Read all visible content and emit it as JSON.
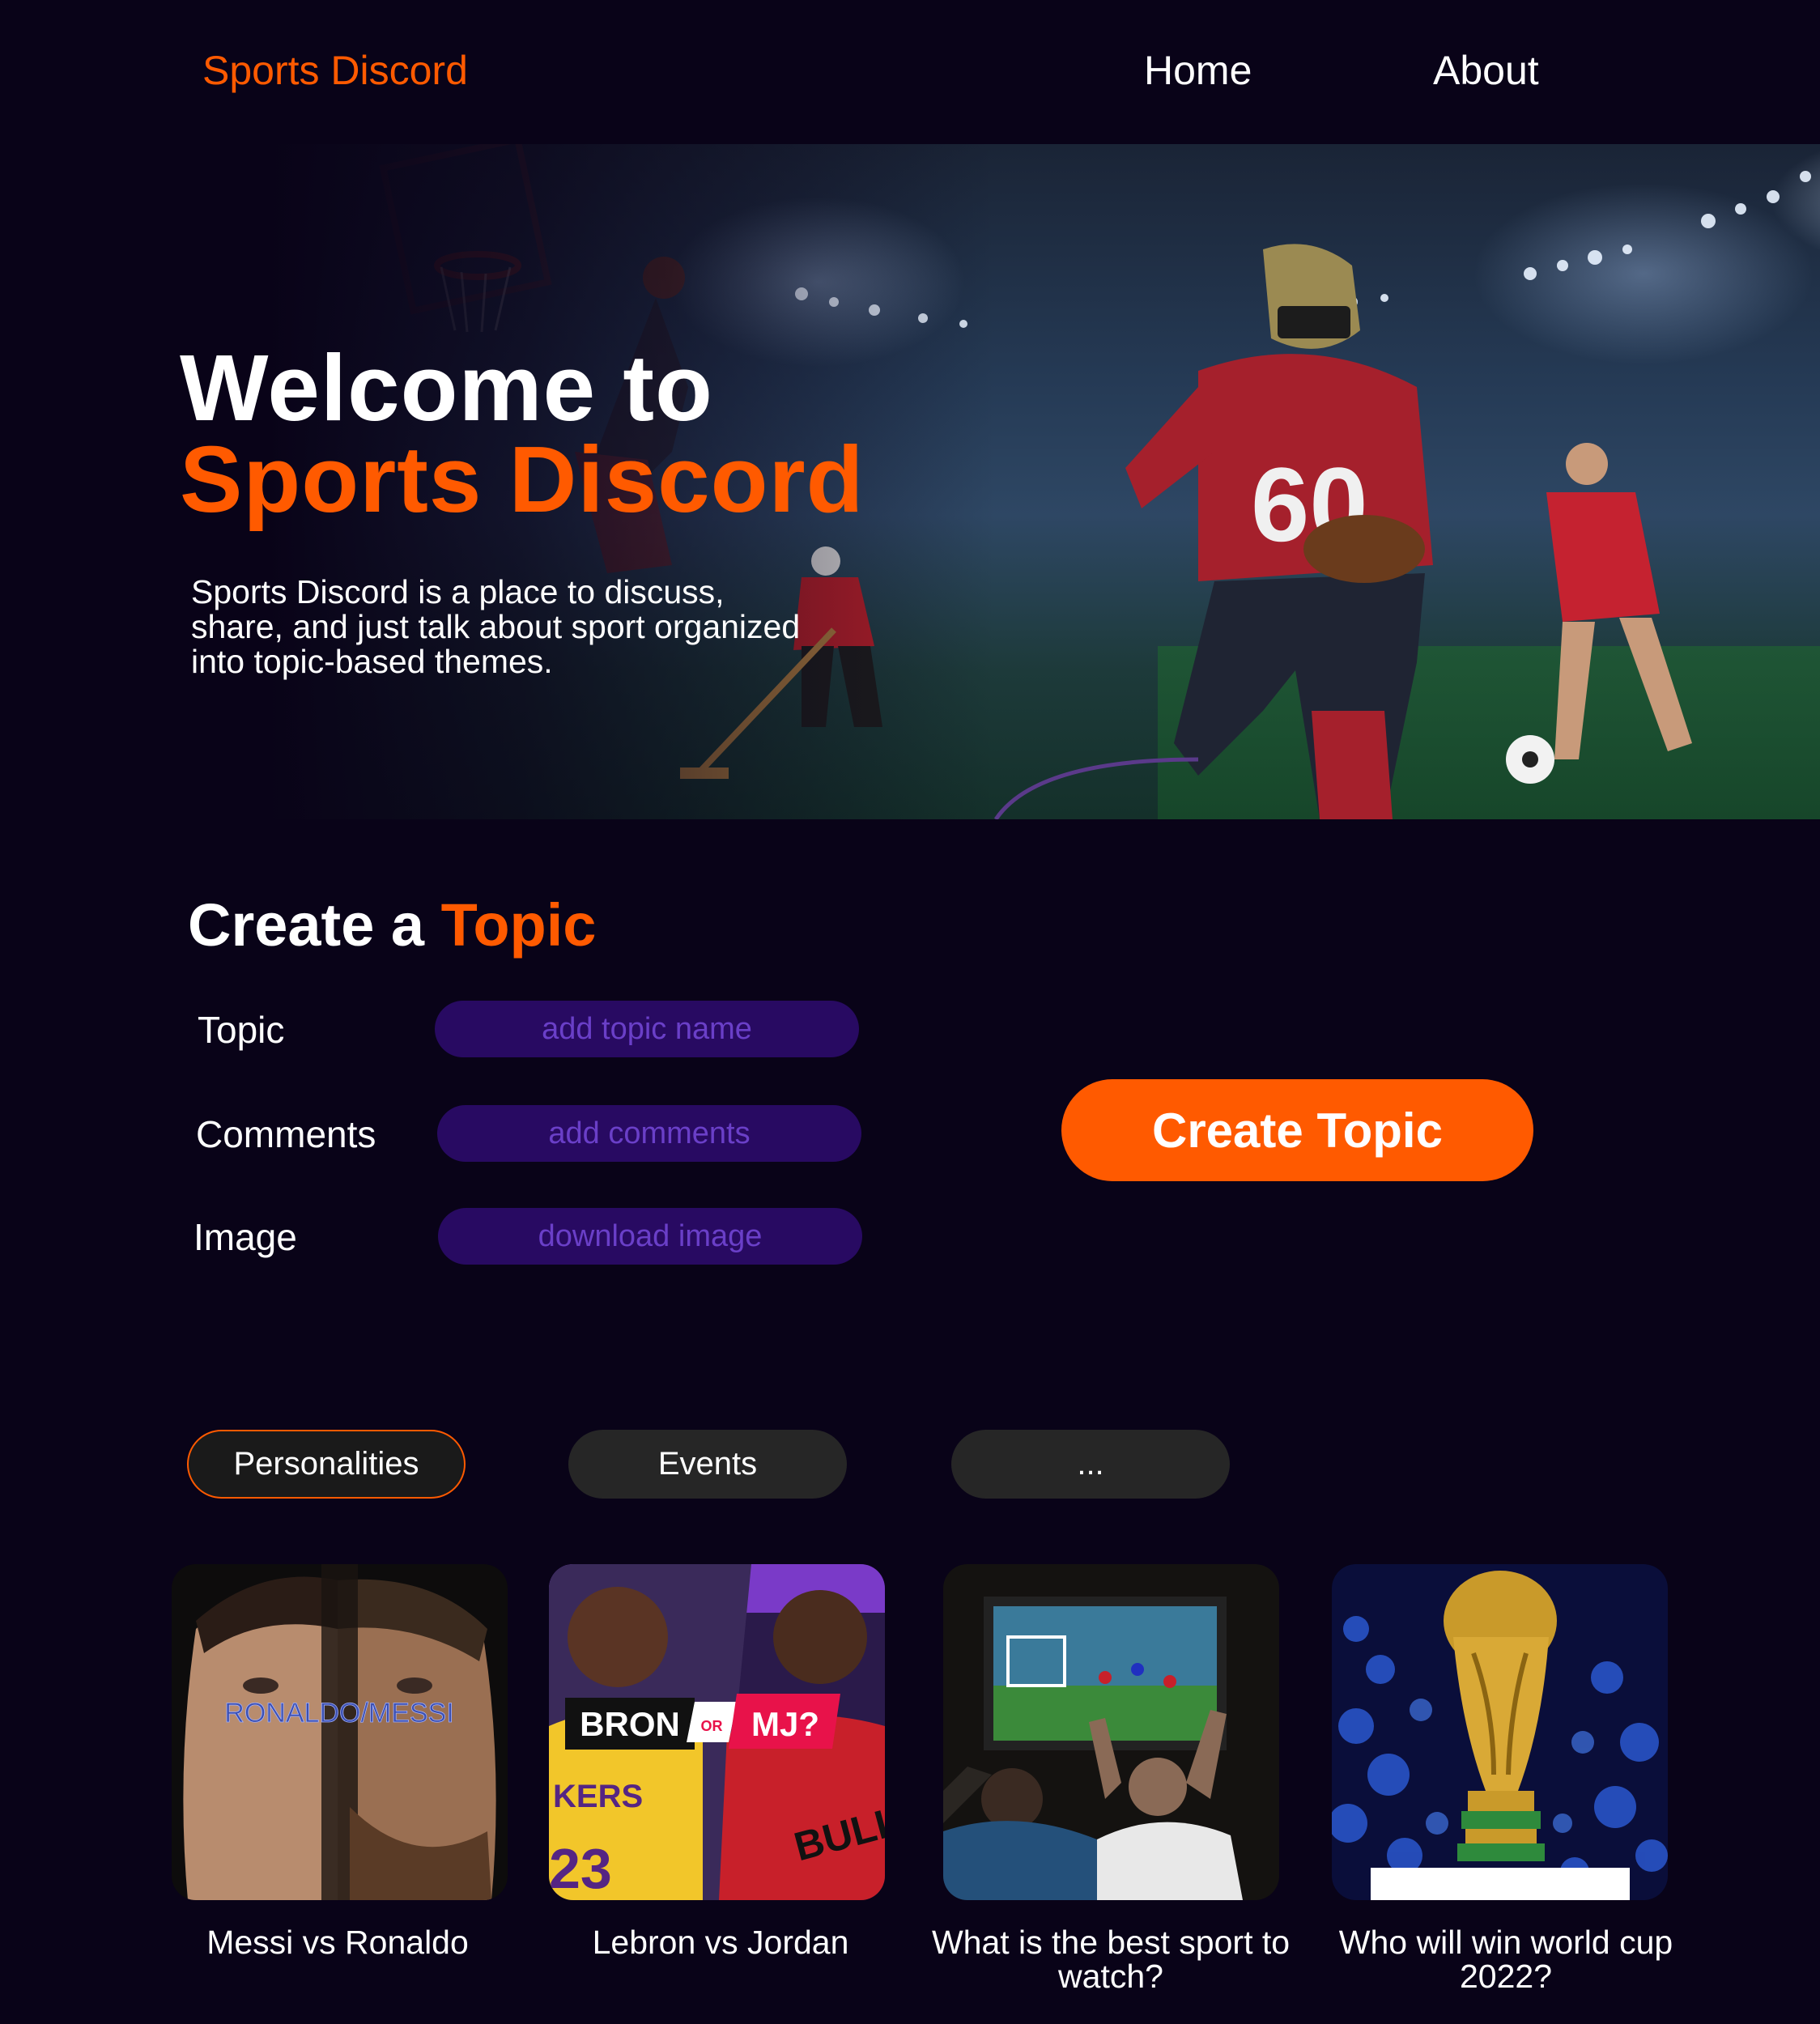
{
  "nav": {
    "brand": "Sports Discord",
    "links": [
      "Home",
      "About"
    ]
  },
  "hero": {
    "title_line1": "Welcome to",
    "title_line2": "Sports Discord",
    "description": "Sports Discord is a place to discuss, share, and just talk about sport organized into topic-based themes."
  },
  "create_topic": {
    "title_prefix": "Create a",
    "title_accent": "Topic",
    "fields": [
      {
        "label": "Topic",
        "placeholder": "add topic name"
      },
      {
        "label": "Comments",
        "placeholder": "add comments"
      },
      {
        "label": "Image",
        "placeholder": "download image"
      }
    ],
    "button_label": "Create Topic"
  },
  "filters": {
    "tabs": [
      "Personalities",
      "Events",
      "..."
    ],
    "active": "Personalities"
  },
  "cards": [
    {
      "caption": "Messi vs Ronaldo",
      "image_text": "RONALDO/MESSI"
    },
    {
      "caption": "Lebron vs Jordan",
      "image_text_left": "BRON",
      "image_text_mid": "OR",
      "image_text_right": "MJ?"
    },
    {
      "caption": "What is the best sport to watch?"
    },
    {
      "caption": "Who will win world cup 2022?"
    }
  ],
  "colors": {
    "background": "#090318",
    "accent": "#ff5a00",
    "field_bg": "#280a62",
    "field_text": "#6a3fc8",
    "tab_bg": "#262626"
  }
}
